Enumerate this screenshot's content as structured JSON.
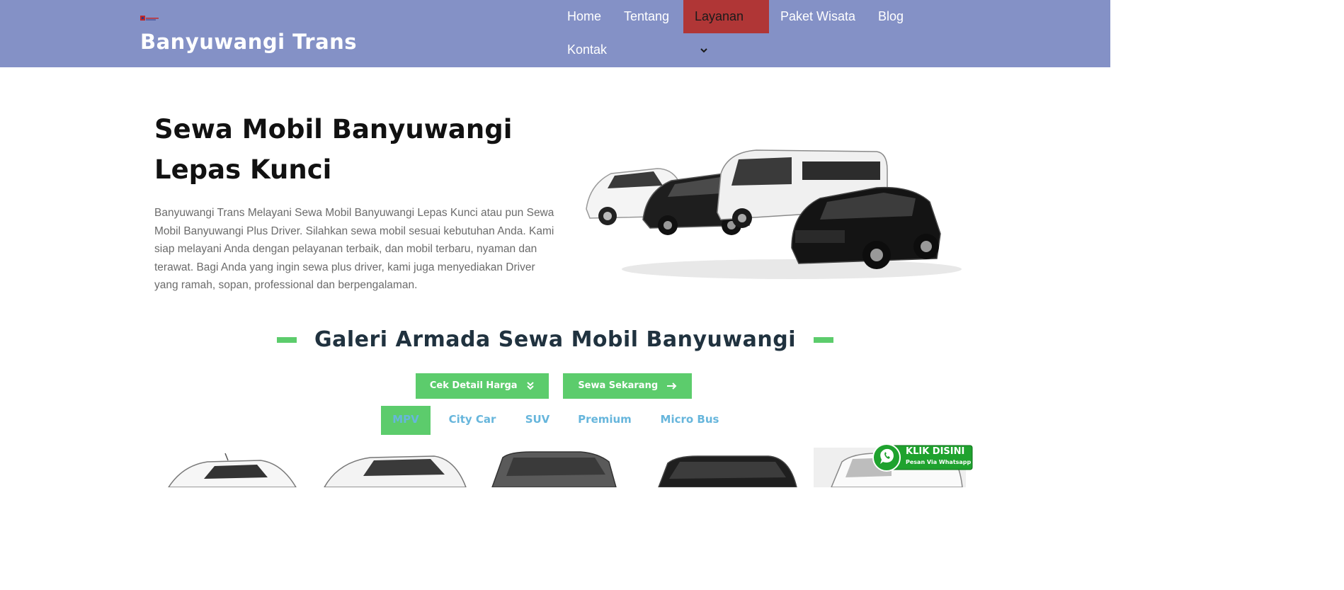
{
  "header": {
    "brand": "Banyuwangi Trans",
    "nav": {
      "home": "Home",
      "tentang": "Tentang",
      "layanan": "Layanan",
      "paket": "Paket Wisata",
      "blog": "Blog",
      "kontak": "Kontak"
    },
    "active_color": "#b03636",
    "bg_color": "#8491c6"
  },
  "hero": {
    "title_line1": "Sewa Mobil Banyuwangi",
    "title_line2": "Lepas Kunci",
    "text": "Banyuwangi Trans Melayani Sewa Mobil Banyuwangi Lepas Kunci atau pun Sewa Mobil Banyuwangi Plus Driver. Silahkan sewa mobil sesuai kebutuhan Anda. Kami siap melayani Anda dengan pelayanan terbaik, dan mobil terbaru, nyaman dan terawat. Bagi Anda yang ingin sewa plus driver, kami juga menyediakan Driver yang ramah, sopan, professional dan berpengalaman."
  },
  "gallery": {
    "title": "Galeri Armada Sewa Mobil Banyuwangi",
    "btn_harga": "Cek Detail Harga",
    "btn_sewa": "Sewa Sekarang",
    "tabs": [
      "MPV",
      "City Car",
      "SUV",
      "Premium",
      "Micro Bus"
    ],
    "accent": "#5ccc6c"
  },
  "whatsapp": {
    "label": "KLIK DISINI",
    "sub": "Pesan Via Whatsapp"
  }
}
